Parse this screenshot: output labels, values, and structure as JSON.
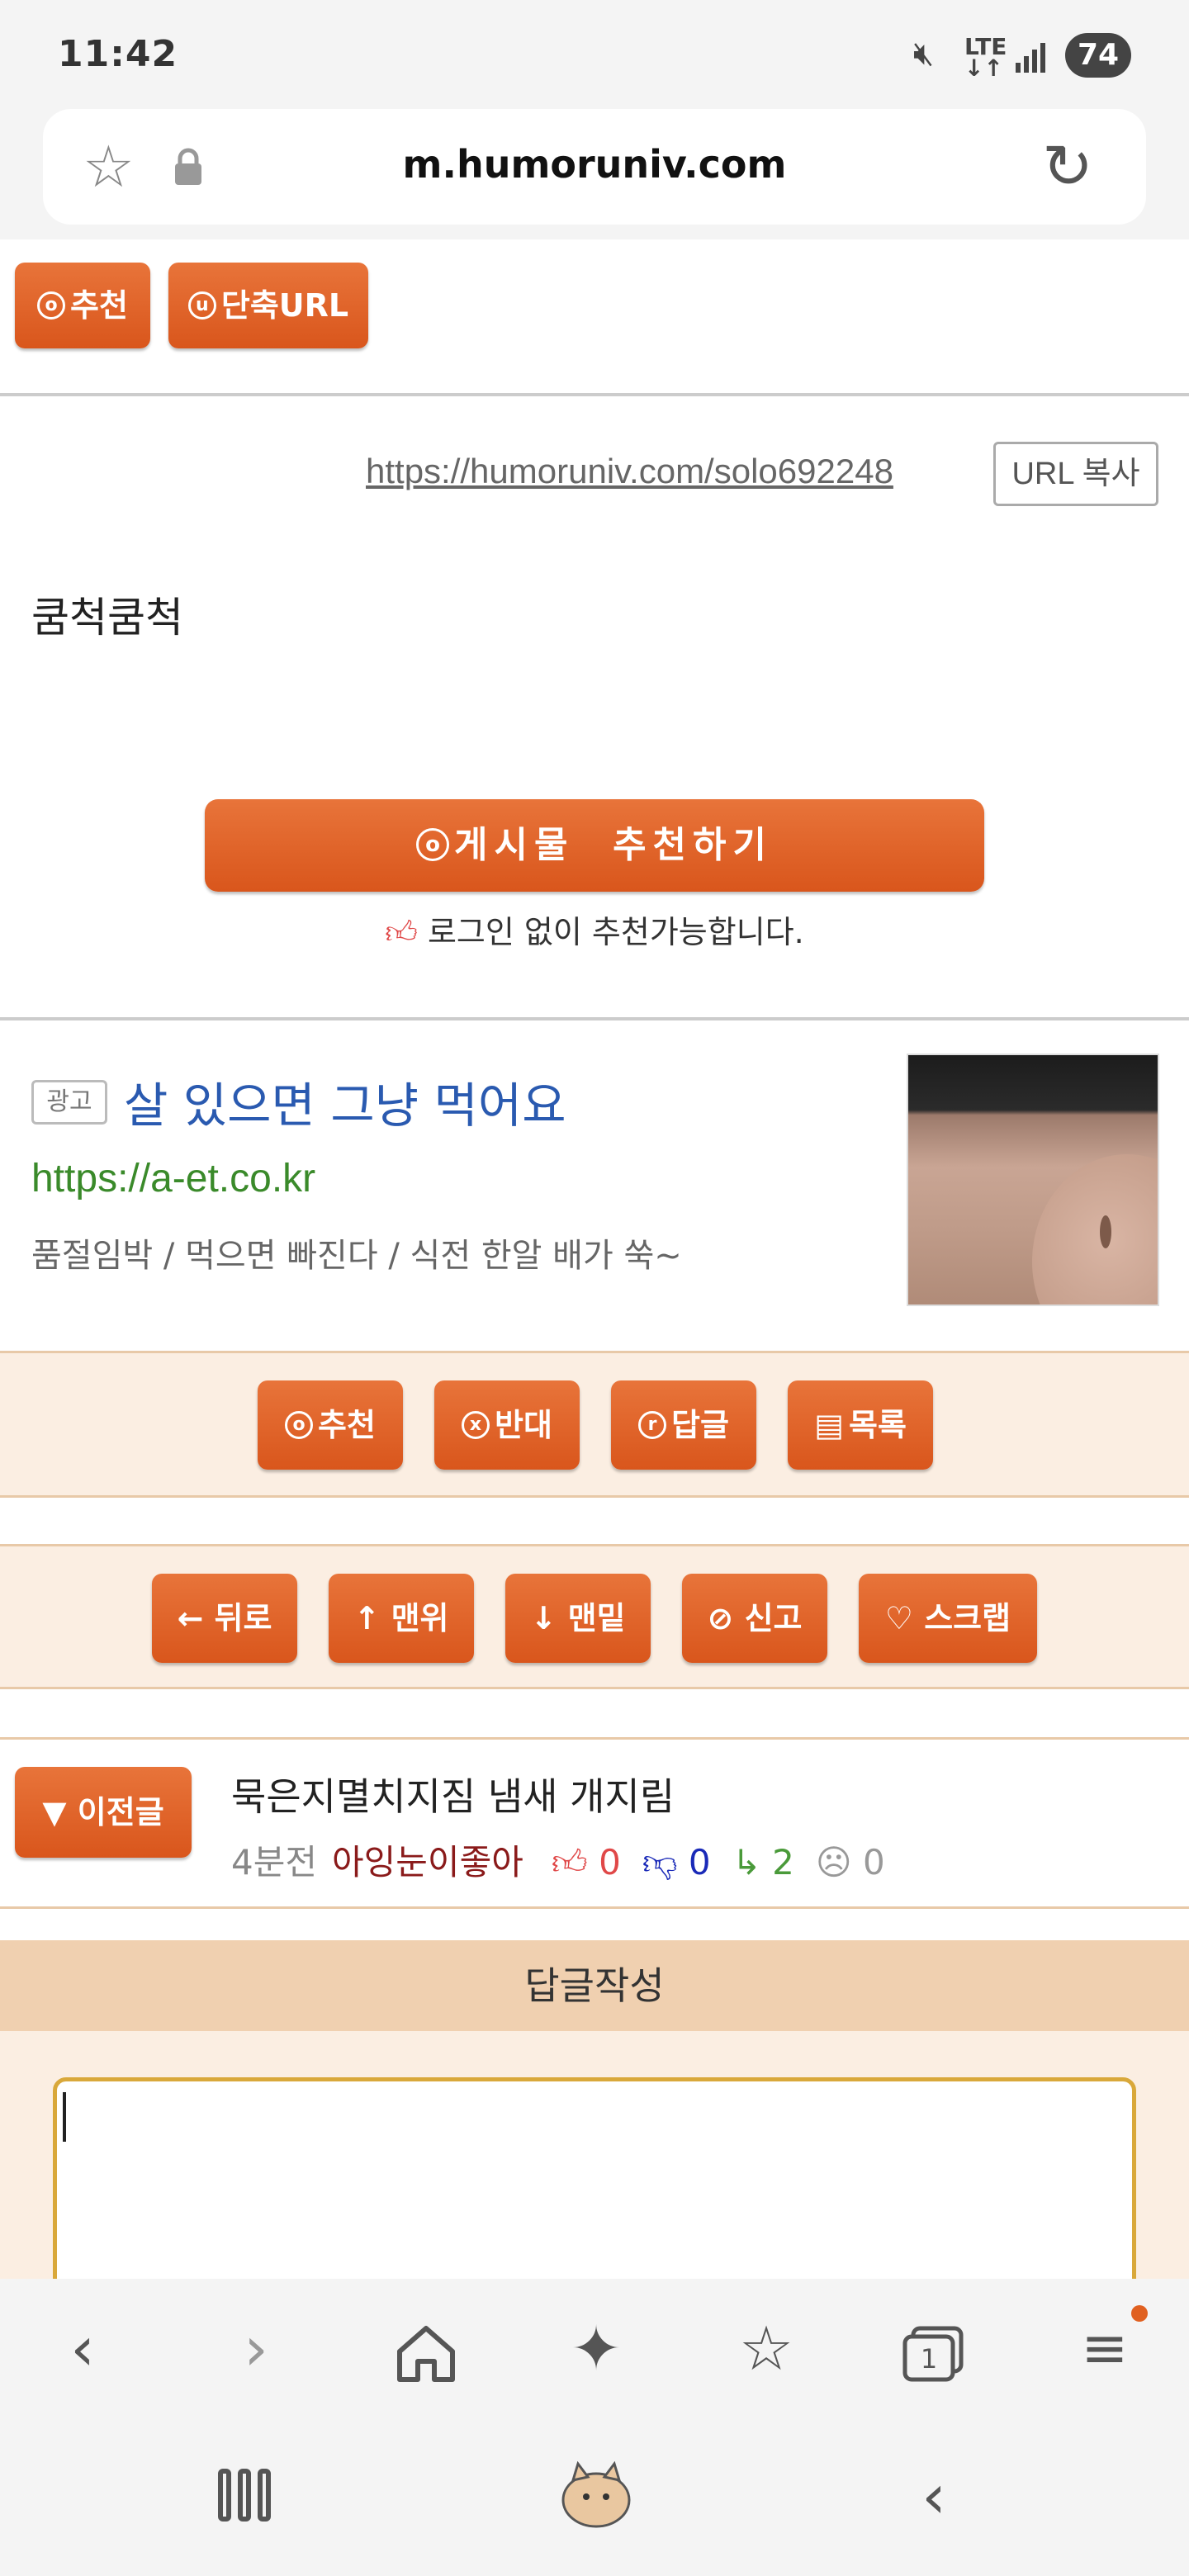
{
  "status_bar": {
    "time": "11:42",
    "battery": "74",
    "network": "LTE",
    "icons": [
      "mute-icon",
      "lte-icon",
      "signal-icon",
      "battery-icon"
    ]
  },
  "address_bar": {
    "url": "m.humoruniv.com",
    "icons": [
      "star-icon",
      "lock-icon",
      "reload-icon"
    ]
  },
  "top_buttons": {
    "recommend_label": "추천",
    "short_url_label": "단축URL",
    "recommend_glyph": "o",
    "short_url_glyph": "u"
  },
  "share": {
    "short_link": "https://humoruniv.com/solo692248",
    "copy_label": "URL 복사"
  },
  "post": {
    "body": "쿰척쿰척",
    "recommend_button": "게시물  추천하기",
    "recommend_glyph": "o",
    "login_note": "로그인 없이 추천가능합니다."
  },
  "ad": {
    "badge": "광고",
    "title": "살 있으면 그냥 먹어요",
    "url": "https://a-et.co.kr",
    "description": "품절임박 / 먹으면 빠진다 / 식전 한알 배가 쑥~"
  },
  "action_bar_1": [
    {
      "glyph": "o",
      "label": "추천"
    },
    {
      "glyph": "x",
      "label": "반대"
    },
    {
      "glyph": "r",
      "label": "답글"
    },
    {
      "glyph": "▤",
      "label": "목록"
    }
  ],
  "action_bar_2": [
    {
      "glyph": "←",
      "label": "뒤로"
    },
    {
      "glyph": "↑",
      "label": "맨위"
    },
    {
      "glyph": "↓",
      "label": "맨밑"
    },
    {
      "glyph": "⊘",
      "label": "신고"
    },
    {
      "glyph": "♡",
      "label": "스크랩"
    }
  ],
  "prev_post": {
    "button_label": "▼ 이전글",
    "title": "묵은지멸치지짐 냄새 개지림",
    "time": "4분전",
    "author": "아잉눈이좋아",
    "up": "0",
    "down": "0",
    "replies": "2",
    "views": "0"
  },
  "reply": {
    "header": "답글작성",
    "value": ""
  },
  "nav_bar": {
    "icons": [
      "back-icon",
      "forward-icon",
      "home-icon",
      "sparkle-icon",
      "bookmarks-icon",
      "tabs-icon",
      "menu-icon"
    ],
    "tab_count": "1",
    "accent": "#e06020"
  },
  "colors": {
    "button_orange": "#d9561c",
    "ad_title_blue": "#2a5ab0",
    "ad_url_green": "#3a8a2a",
    "bar_bg": "#fbeee2",
    "reply_header_bg": "#f0d0b0"
  }
}
